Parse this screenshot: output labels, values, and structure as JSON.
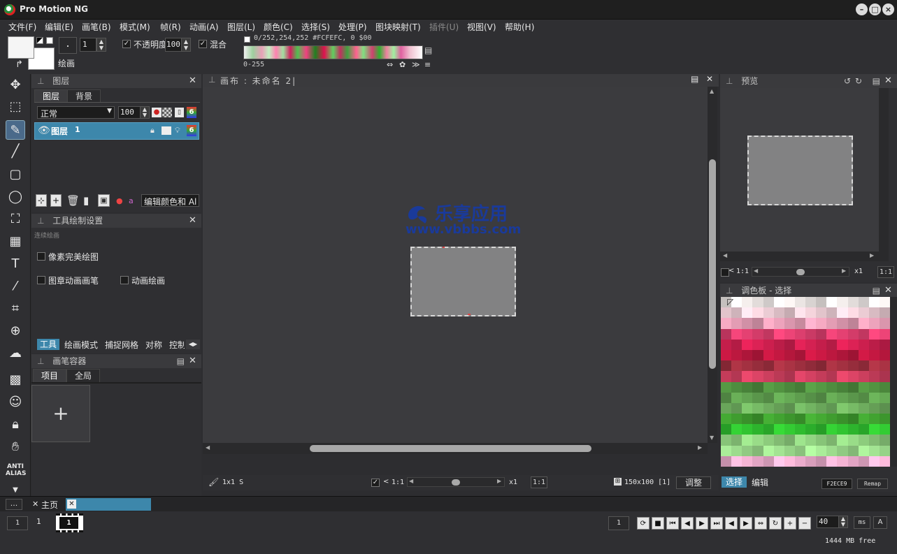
{
  "window": {
    "title": "Pro Motion NG"
  },
  "menu": [
    "文件(F)",
    "编辑(E)",
    "画笔(B)",
    "模式(M)",
    "帧(R)",
    "动画(A)",
    "图层(L)",
    "颜色(C)",
    "选择(S)",
    "处理(P)",
    "图块映射(T)",
    "插件(U)",
    "视图(V)",
    "帮助(H)"
  ],
  "toolbar": {
    "brush_size": "1",
    "opaque_label": "不透明度",
    "opacity_value": "100",
    "blend_label": "混合",
    "color_info": "0/252,254,252 #FCFEFC, 0 $00",
    "range_label": "0-255",
    "draw_label": "绘画",
    "fg_color": "#f5f5f5",
    "bg_color": "#ffffff"
  },
  "layers_panel": {
    "title": "图层",
    "tabs": [
      "图层",
      "背景"
    ],
    "blend_mode": "正常",
    "opacity": "100",
    "layer_name": "图层",
    "layer_number": "1",
    "edit_color_label": "编辑颜色和 Al"
  },
  "tool_settings": {
    "title": "工具绘制设置",
    "subtitle": "连续绘画",
    "pixel_perfect": "像素完美绘图",
    "stamp_anim_brush": "图章动画画笔",
    "anim_draw": "动画绘画",
    "tabs": [
      "工具",
      "绘画模式",
      "捕捉网格",
      "对称",
      "控制"
    ]
  },
  "brush_container": {
    "title": "画笔容器",
    "tabs": [
      "项目",
      "全局"
    ],
    "add_glyph": "+"
  },
  "canvas": {
    "title": "画布 : 未命名 2|",
    "brush_info": "1x1 S",
    "zoom_ratio": "1:1",
    "zoom_factor": "x1",
    "zoom_ratio2": "1:1",
    "size_info": "150x100 [1]",
    "adjust_label": "调整",
    "watermark_cn": "乐享应用",
    "watermark_url": "www.vbbbs.com"
  },
  "preview_panel": {
    "title": "预览",
    "zoom_ratio": "1:1",
    "zoom_factor": "x1",
    "zoom_ratio2": "1:1"
  },
  "palette_panel": {
    "title": "调色板 - 选择",
    "tab_select": "选择",
    "tab_edit": "编辑",
    "hex_value": "F2ECE9",
    "remap_label": "Remap"
  },
  "bottom_tabs": {
    "more": "...",
    "home": "主页"
  },
  "timeline": {
    "start_frame": "1",
    "current_frame": "1",
    "frame_thumb": "1",
    "right_frame": "1",
    "delay": "40",
    "ms_label": "ms",
    "a_label": "A",
    "memory": "1444 MB free"
  },
  "colors": {
    "accent": "#3d87ab",
    "panel": "#2f2f32",
    "canvas_bg": "#3b3b3e",
    "canvas_rect": "#828283",
    "watermark": "#1a3a9a"
  }
}
